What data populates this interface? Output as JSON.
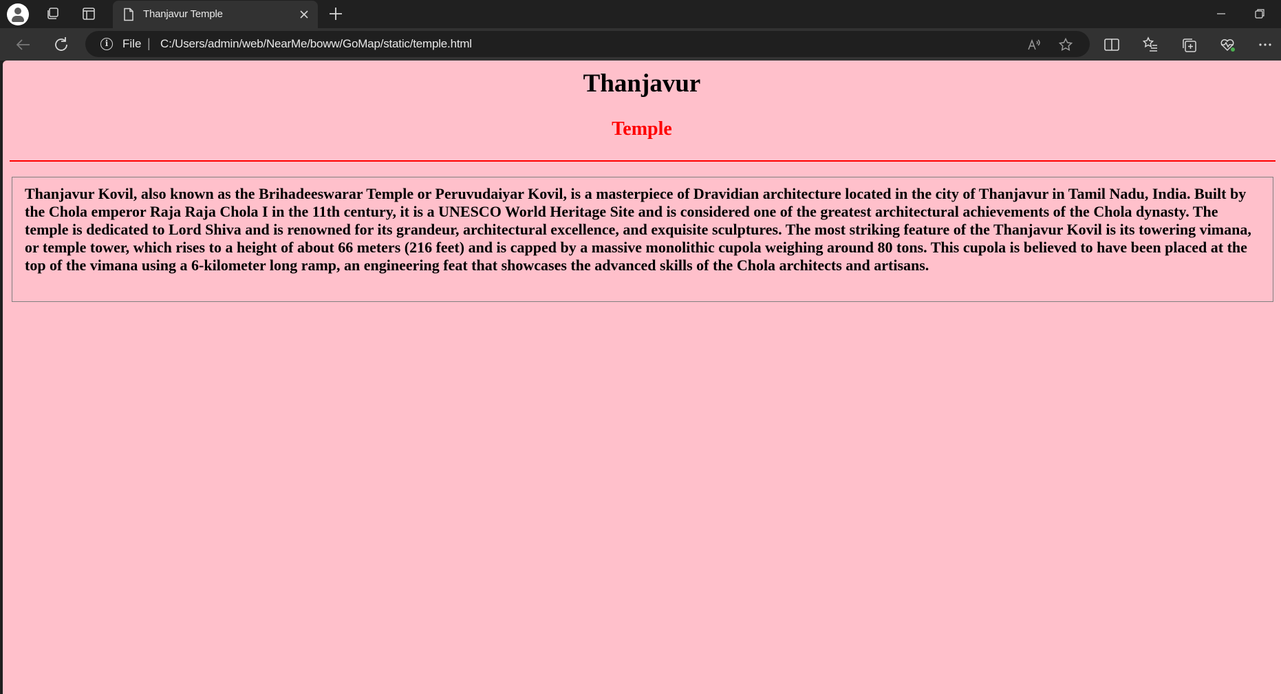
{
  "browser": {
    "tab": {
      "title": "Thanjavur Temple"
    },
    "address": {
      "scheme_label": "File",
      "separator": "|",
      "url": "C:/Users/admin/web/NearMe/boww/GoMap/static/temple.html"
    },
    "colors": {
      "titlebar": "#202020",
      "toolbar": "#323232",
      "addressbar": "#1f1f1f"
    }
  },
  "page": {
    "title": "Thanjavur",
    "subtitle": "Temple",
    "description": "Thanjavur Kovil, also known as the Brihadeeswarar Temple or Peruvudaiyar Kovil, is a masterpiece of Dravidian architecture located in the city of Thanjavur in Tamil Nadu, India. Built by the Chola emperor Raja Raja Chola I in the 11th century, it is a UNESCO World Heritage Site and is considered one of the greatest architectural achievements of the Chola dynasty. The temple is dedicated to Lord Shiva and is renowned for its grandeur, architectural excellence, and exquisite sculptures. The most striking feature of the Thanjavur Kovil is its towering vimana, or temple tower, which rises to a height of about 66 meters (216 feet) and is capped by a massive monolithic cupola weighing around 80 tons. This cupola is believed to have been placed at the top of the vimana using a 6-kilometer long ramp, an engineering feat that showcases the advanced skills of the Chola architects and artisans.",
    "colors": {
      "background": "#ffc0cb",
      "subtitle": "#ff0000",
      "rule": "#ff0000"
    }
  },
  "icons": {
    "profile": "profile-avatar-icon",
    "workspaces": "workspaces-icon",
    "tab_actions": "vertical-tabs-icon",
    "tab_page": "page-icon",
    "tab_close": "close-icon",
    "new_tab": "plus-icon",
    "minimize": "minimize-icon",
    "restore": "restore-icon",
    "back": "back-arrow-icon",
    "refresh": "refresh-icon",
    "info": "info-icon",
    "read_aloud": "read-aloud-icon",
    "favorite": "star-icon",
    "split_screen": "split-screen-icon",
    "favorites": "favorites-list-icon",
    "collections": "collections-icon",
    "browser_essentials": "heartbeat-icon",
    "more": "more-icon"
  }
}
